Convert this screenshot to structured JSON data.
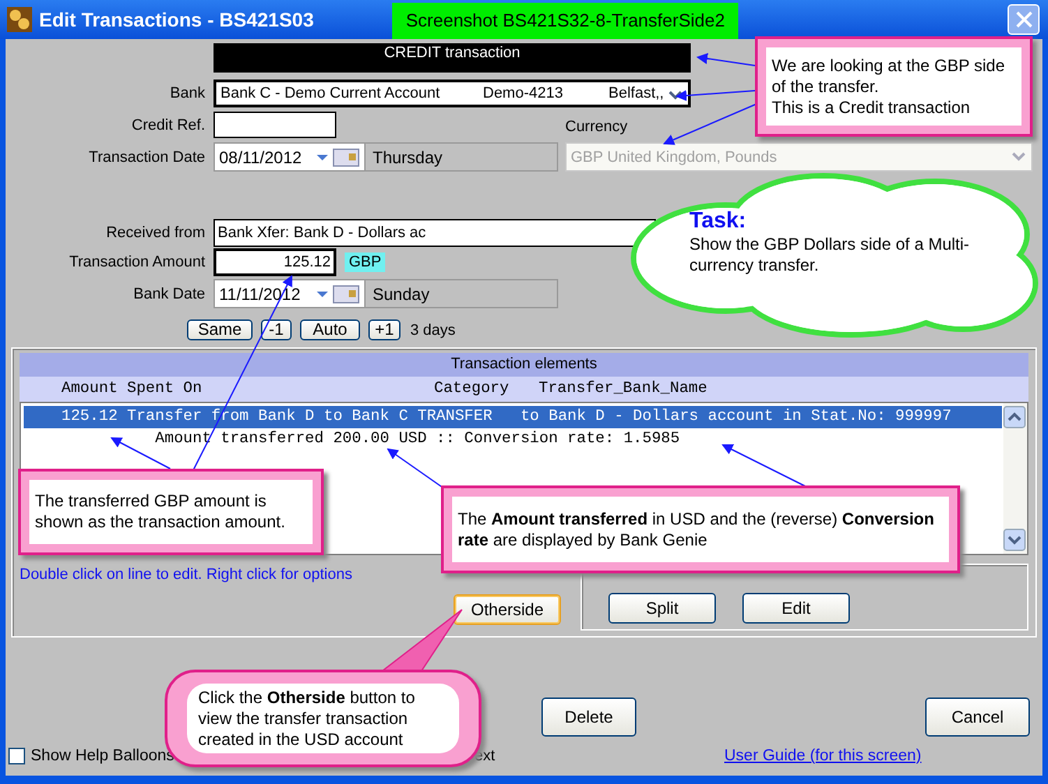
{
  "window": {
    "title": "Edit Transactions - BS421S03",
    "banner": "Screenshot BS421S32-8-TransferSide2"
  },
  "form": {
    "type_bar": "CREDIT transaction",
    "bank": {
      "label": "Bank",
      "name": "Bank C - Demo Current Account",
      "number": "Demo-4213",
      "place": "Belfast,,"
    },
    "credit_ref": {
      "label": "Credit Ref."
    },
    "currency": {
      "label": "Currency",
      "value": "GBP United Kingdom, Pounds",
      "disabled": true
    },
    "transaction_date": {
      "label": "Transaction Date",
      "value": "08/11/2012",
      "day": "Thursday"
    },
    "received_from": {
      "label": "Received from",
      "value": "Bank Xfer: Bank D - Dollars ac"
    },
    "amount": {
      "label": "Transaction Amount",
      "value": "125.12",
      "currency_tag": "GBP"
    },
    "bank_date": {
      "label": "Bank Date",
      "value": "11/11/2012",
      "day": "Sunday"
    },
    "date_buttons": [
      "Same",
      "-1",
      "Auto",
      "+1"
    ],
    "days": "3 days"
  },
  "elements": {
    "title": "Transaction elements",
    "columns": [
      "Amount Spent On",
      "Category",
      "Transfer_Bank_Name"
    ],
    "rows": [
      {
        "text": "125.12 Transfer from Bank D to Bank C TRANSFER   to Bank D - Dollars account in Stat.No: 999997",
        "selected": true
      },
      {
        "text": "          Amount transferred 200.00 USD :: Conversion rate: 1.5985",
        "selected": false
      }
    ],
    "hint": "Double click on line to edit. Right click for options",
    "otherside_button": "Otherside",
    "group_buttons": [
      "Split",
      "Edit"
    ]
  },
  "footer": {
    "delete_button": "Delete",
    "cancel_button": "Cancel",
    "help_balloons": {
      "label": "Show Help Balloons",
      "checked": false
    },
    "fragment": "ext",
    "link": "User Guide (for this screen)"
  },
  "callouts": [
    {
      "kind": "box",
      "text": "We are looking at the GBP side of the transfer.\nThis is a Credit transaction"
    },
    {
      "kind": "cloud",
      "heading": "Task:",
      "text": "Show the GBP Dollars side of a Multi-currency transfer."
    },
    {
      "kind": "box",
      "text": "The transferred GBP amount is shown as the transaction amount."
    },
    {
      "kind": "box",
      "text": "The **Amount transferred** in USD and the (reverse) **Conversion rate** are displayed by Bank Genie"
    },
    {
      "kind": "rounded",
      "text": "Click the **Otherside** button to view the transfer transaction created in the USD account"
    }
  ]
}
